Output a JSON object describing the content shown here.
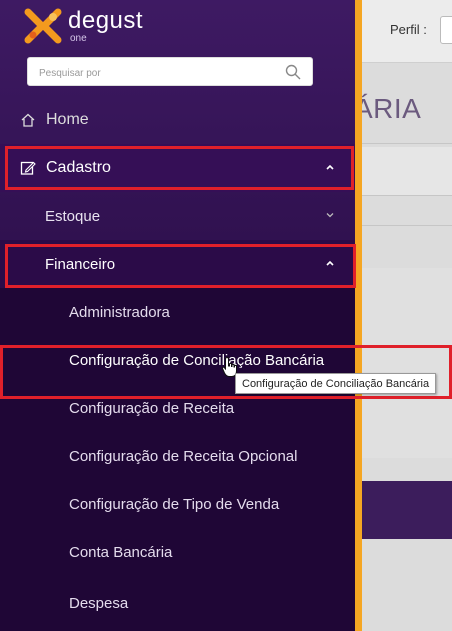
{
  "app": {
    "logo_text": "degust",
    "logo_sub": "one",
    "perfil_label": "Perfil :",
    "page_title_fragment": "ÁRIA"
  },
  "search": {
    "placeholder": "Pesquisar por",
    "value": ""
  },
  "sidebar": {
    "home": "Home",
    "cadastro": "Cadastro",
    "estoque": "Estoque",
    "financeiro": "Financeiro",
    "items": [
      "Administradora",
      "Configuração de Conciliação Bancária",
      "Configuração de Receita",
      "Configuração de Receita Opcional",
      "Configuração de Tipo de Venda",
      "Conta Bancária",
      "Despesa"
    ]
  },
  "tooltip": "Configuração de Conciliação Bancária",
  "colors": {
    "sidebar_top": "#3e1a63",
    "sidebar_bottom": "#20073a",
    "accent_orange": "#f5a623",
    "highlight_red": "#e0202a",
    "logo_orange": "#f39a1e"
  }
}
